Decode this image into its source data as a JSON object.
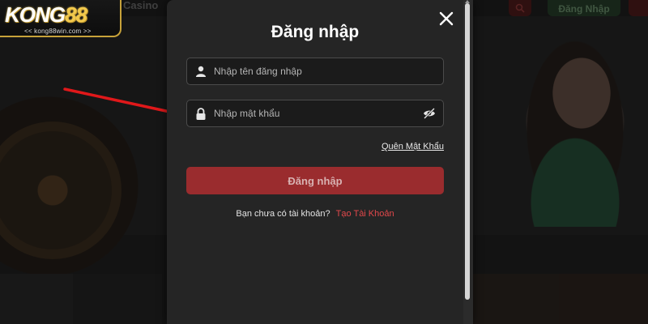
{
  "background": {
    "nav_casino": "Casino",
    "login_button": "Đăng Nhập"
  },
  "logo": {
    "brand_main": "KONG",
    "brand_num": "88",
    "tagline": "<< kong88win.com >>"
  },
  "modal": {
    "title": "Đăng nhập",
    "username": {
      "placeholder": "Nhập tên đăng nhập",
      "icon": "user-icon"
    },
    "password": {
      "placeholder": "Nhập mật khẩu",
      "icon": "lock-icon",
      "toggle_icon": "eye-off-icon"
    },
    "forgot_link": "Quên Mật Khẩu",
    "submit_label": "Đăng nhập",
    "no_account_text": "Bạn chưa có tài khoản?",
    "create_account_link": "Tạo Tài Khoản",
    "close_icon": "close-icon"
  },
  "colors": {
    "modal_bg": "#252525",
    "submit_bg": "#9a2c2e",
    "link_red": "#e2484b",
    "annotation_arrow": "#e0181a"
  }
}
